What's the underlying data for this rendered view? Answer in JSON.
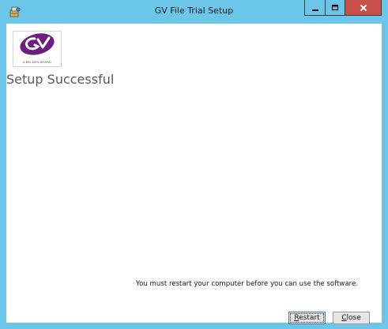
{
  "window": {
    "title": "GV File Trial Setup",
    "icon": "installer-icon",
    "controls": {
      "minimize_icon": "minimize-icon",
      "maximize_icon": "maximize-icon",
      "close_icon": "close-icon"
    }
  },
  "logo": {
    "brand": "GV",
    "tagline": "A BELDEN BRAND",
    "color": "#6d1f7e"
  },
  "main": {
    "heading": "Setup Successful",
    "message": "You must restart your computer before you can use the software."
  },
  "buttons": {
    "restart_mnemonic": "R",
    "restart_rest": "estart",
    "close_mnemonic": "C",
    "close_rest": "lose"
  },
  "colors": {
    "titlebar": "#6cc6ea",
    "close_button": "#c7504a"
  }
}
